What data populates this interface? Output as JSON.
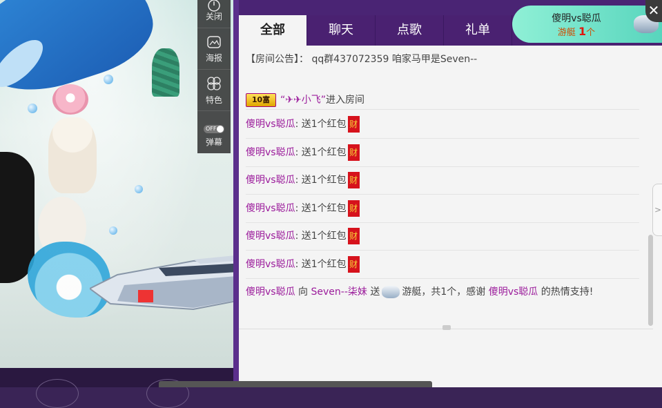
{
  "sidebar_tools": [
    {
      "name": "close",
      "label": "关闭"
    },
    {
      "name": "poster",
      "label": "海报"
    },
    {
      "name": "features",
      "label": "特色"
    },
    {
      "name": "danmaku",
      "label": "弹幕",
      "toggle": "OFF"
    }
  ],
  "tabs": [
    {
      "label": "全部",
      "active": true
    },
    {
      "label": "聊天",
      "active": false
    },
    {
      "label": "点歌",
      "active": false
    },
    {
      "label": "礼单",
      "active": false
    }
  ],
  "gift_card": {
    "user": "傻明vs聪瓜",
    "gift_name": "游艇",
    "count": "1",
    "unit": "个"
  },
  "close_symbol": "✕",
  "chat": {
    "notice_prefix": "【房间公告】：",
    "notice_text": "qq群437072359 咱家马甲是Seven--",
    "enter": {
      "level_badge": "10富",
      "user": "“✈✈小飞”",
      "action": "进入房间"
    },
    "red_packet_rows": [
      {
        "user": "傻明vs聪瓜",
        "text": ": 送1个红包",
        "badge": "财"
      },
      {
        "user": "傻明vs聪瓜",
        "text": ": 送1个红包",
        "badge": "财"
      },
      {
        "user": "傻明vs聪瓜",
        "text": ": 送1个红包",
        "badge": "财"
      },
      {
        "user": "傻明vs聪瓜",
        "text": ": 送1个红包",
        "badge": "财"
      },
      {
        "user": "傻明vs聪瓜",
        "text": ": 送1个红包",
        "badge": "财"
      },
      {
        "user": "傻明vs聪瓜",
        "text": ": 送1个红包",
        "badge": "财"
      }
    ],
    "gift_message": {
      "sender": "傻明vs聪瓜",
      "to_word": "向",
      "receiver": "Seven--柒妹",
      "send_word": "送",
      "gift": "游艇，共1个，感谢",
      "thank_user": "傻明vs聪瓜",
      "suffix": "的热情支持!"
    }
  },
  "colors": {
    "tab_bar": "#4a2171",
    "username": "#9b1b9b",
    "red_packet": "#d6121c"
  },
  "icons": [
    "power-icon",
    "image-icon",
    "circles-icon",
    "toggle-icon",
    "boat-icon",
    "chevron-right-icon",
    "chevron-up-icon"
  ]
}
